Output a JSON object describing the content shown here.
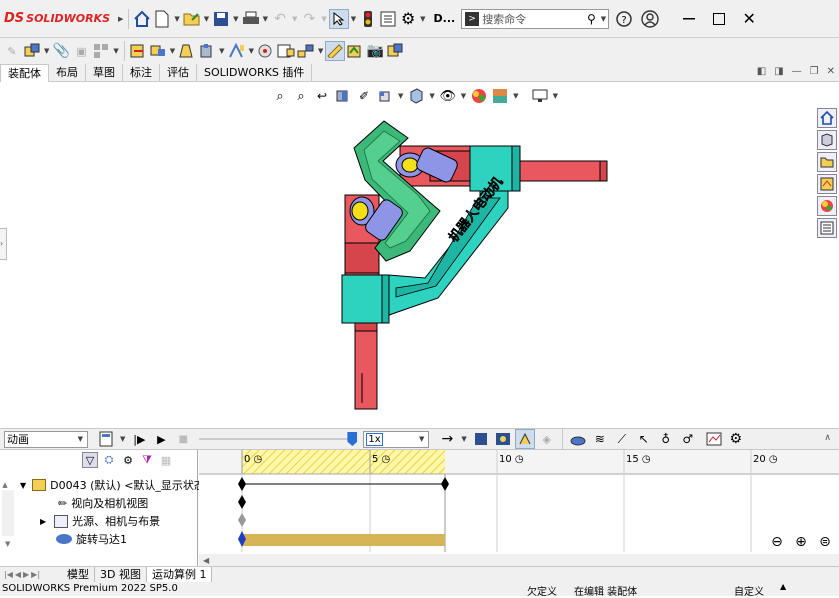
{
  "app": {
    "logo_prefix": "DS",
    "logo_text": "SOLIDWORKS",
    "doc_short": "D...",
    "search_placeholder": "搜索命令"
  },
  "tabs": [
    "装配体",
    "布局",
    "草图",
    "标注",
    "评估",
    "SOLIDWORKS 插件"
  ],
  "motion": {
    "study_type": "动画",
    "speed": "1x"
  },
  "timeline": {
    "ticks": [
      "0",
      "5",
      "10",
      "15",
      "20"
    ]
  },
  "tree": {
    "root": "D0043 (默认) <默认_显示状态",
    "items": [
      "视向及相机视图",
      "光源、相机与布景",
      "旋转马达1"
    ]
  },
  "bottom_tabs": [
    "模型",
    "3D 视图",
    "运动算例 1"
  ],
  "status": {
    "version": "SOLIDWORKS Premium 2022 SP5.0",
    "underdefined": "欠定义",
    "editing": "在编辑 装配体",
    "custom": "自定义"
  },
  "model_text": "机器人电动机",
  "colors": {
    "green": "#3cb878",
    "cyan": "#2ed3c0",
    "red": "#e8585e",
    "yellow": "#f3e01a",
    "lavender": "#8f95e6",
    "accent_blue": "#2a6fd6",
    "timeline_gold": "#d7b456"
  }
}
